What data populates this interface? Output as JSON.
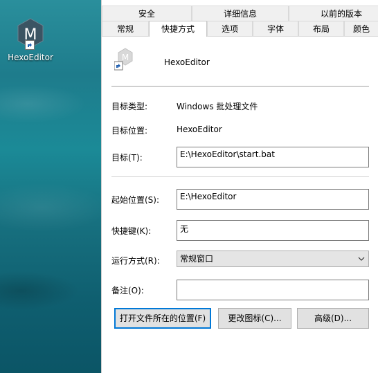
{
  "desktop": {
    "icon_label": "HexoEditor",
    "icon_letter": "M"
  },
  "dialog": {
    "tabs_top": [
      "安全",
      "详细信息",
      "以前的版本"
    ],
    "tabs_bottom": [
      "常规",
      "快捷方式",
      "选项",
      "字体",
      "布局",
      "颜色"
    ],
    "active_tab": "快捷方式",
    "app_name": "HexoEditor",
    "fields": {
      "target_type_label": "目标类型:",
      "target_type_value": "Windows 批处理文件",
      "target_location_label": "目标位置:",
      "target_location_value": "HexoEditor",
      "target_label": "目标(T):",
      "target_value": "E:\\HexoEditor\\start.bat",
      "start_in_label": "起始位置(S):",
      "start_in_value": "E:\\HexoEditor",
      "shortcut_key_label": "快捷键(K):",
      "shortcut_key_value": "无",
      "run_label": "运行方式(R):",
      "run_value": "常规窗口",
      "comment_label": "备注(O):",
      "comment_value": ""
    },
    "buttons": {
      "open_location": "打开文件所在的位置(F)",
      "change_icon": "更改图标(C)...",
      "advanced": "高级(D)..."
    }
  },
  "colors": {
    "accent": "#0078d7",
    "desktop": "#1b7f8e",
    "icon_bg": "#3b5463"
  }
}
